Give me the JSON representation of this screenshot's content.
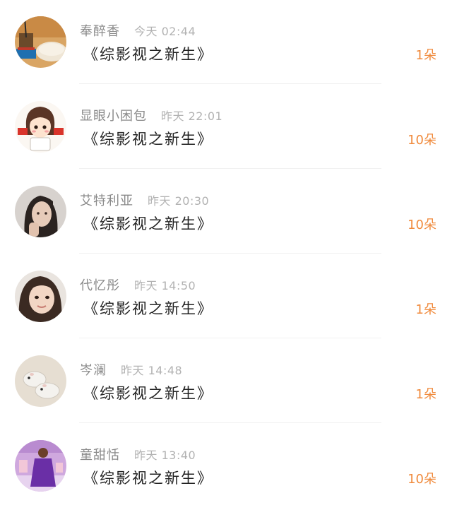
{
  "accent_color": "#f08a3c",
  "gifts": [
    {
      "user": "奉醉香",
      "time": "今天 02:44",
      "book": "《综影视之新生》",
      "amount": "1朵",
      "avatar_icon": "coffee-photo-avatar"
    },
    {
      "user": "显眼小困包",
      "time": "昨天 22:01",
      "book": "《综影视之新生》",
      "amount": "10朵",
      "avatar_icon": "cartoon-girl-avatar"
    },
    {
      "user": "艾特利亚",
      "time": "昨天 20:30",
      "book": "《综影视之新生》",
      "amount": "10朵",
      "avatar_icon": "woman-portrait-avatar"
    },
    {
      "user": "代忆彤",
      "time": "昨天 14:50",
      "book": "《综影视之新生》",
      "amount": "1朵",
      "avatar_icon": "girl-face-avatar"
    },
    {
      "user": "岑澜",
      "time": "昨天 14:48",
      "book": "《综影视之新生》",
      "amount": "1朵",
      "avatar_icon": "hamster-avatar"
    },
    {
      "user": "童甜恬",
      "time": "昨天 13:40",
      "book": "《综影视之新生》",
      "amount": "10朵",
      "avatar_icon": "purple-dress-avatar"
    }
  ]
}
